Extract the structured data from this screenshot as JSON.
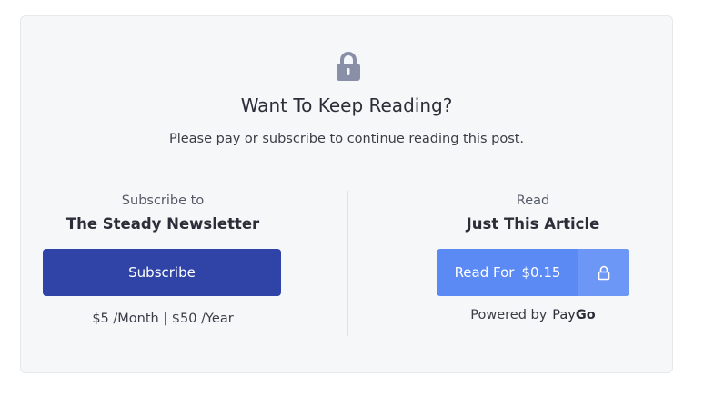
{
  "paywall": {
    "heading": "Want To Keep Reading?",
    "subheading": "Please pay or subscribe to continue reading this post."
  },
  "subscribe": {
    "label": "Subscribe to",
    "title": "The Steady Newsletter",
    "button_label": "Subscribe",
    "pricing": "$5 /Month | $50 /Year"
  },
  "read": {
    "label": "Read",
    "title": "Just This Article",
    "button_label": "Read For",
    "price": "$0.15",
    "powered_by": "Powered by",
    "brand_pay": "Pay",
    "brand_go": "Go"
  },
  "colors": {
    "subscribe_button": "#3044a8",
    "read_button": "#5b8af5",
    "card_background": "#f6f7f9",
    "lock_icon": "#8a8fa8"
  },
  "icons": {
    "top": "lock-icon",
    "read_button": "lock-icon"
  }
}
